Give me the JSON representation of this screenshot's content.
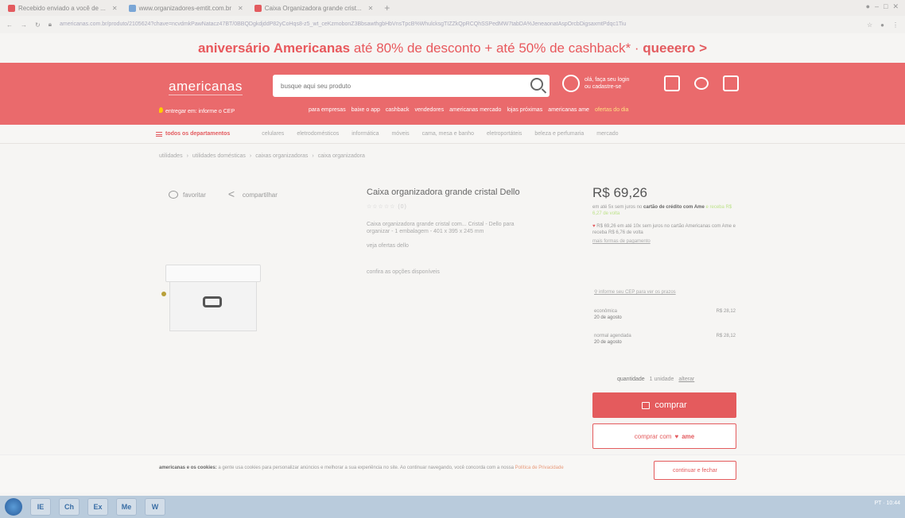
{
  "browser": {
    "tabs": [
      {
        "label": "Recebido enviado a você de ...",
        "color": "#e35b5f"
      },
      {
        "label": "www.organizadores-emtit.com.br",
        "color": "#7aa6d6"
      },
      {
        "label": "Caixa Organizadora grande crist...",
        "color": "#e35b5f"
      }
    ],
    "url": "americanas.com.br/produto/2105624?chave=ncvdmkPawNatacz47BT/0BBQDgkdjddP82yCoHqs8-z5_wt_ceKzmobonZ3BbsawthgbHbVnsTpcB%WhulcksgTIZZkQpRCQhSSPedMW7tabDA%JeneaonatAspOrcbDigsaxmtPdqc1Tiu"
  },
  "promo": {
    "pre": "aniversário ",
    "brand": "Americanas",
    "mid": " até 80% de desconto + até 50% de cashback* · ",
    "cta": "queeero >"
  },
  "header": {
    "logo": "americanas",
    "search_placeholder": "busque aqui seu produto",
    "account_line1": "olá, faça seu login",
    "account_line2": "ou cadastre-se",
    "location": "entregar em: informe o CEP",
    "quicklinks": [
      "para empresas",
      "baixe o app",
      "cashback",
      "vendedores",
      "americanas mercado",
      "lojas próximas",
      "americanas ame"
    ],
    "quicklink_highlight": "ofertas do dia"
  },
  "dept": {
    "button": "todos os departamentos",
    "categories": [
      "celulares",
      "eletrodomésticos",
      "informática",
      "móveis",
      "cama, mesa e banho",
      "eletroportáteis",
      "beleza e perfumaria",
      "mercado"
    ]
  },
  "breadcrumb": [
    "utilidades",
    "utilidades domésticas",
    "caixas organizadoras",
    "caixa organizadora"
  ],
  "product": {
    "favorite": "favoritar",
    "share": "compartilhar",
    "title": "Caixa organizadora grande cristal Dello",
    "stars": "☆☆☆☆☆ (0)",
    "description": "Caixa organizadora grande cristal com... Cristal - Dello para organizar - 1 embalagem - 401 x 395 x 245 mm",
    "brand_link": "veja ofertas dello",
    "seller_link": "confira as opções disponíveis"
  },
  "pricing": {
    "price": "R$ 69,26",
    "installments_pre": "em até 5x sem juros no ",
    "installments_bold": "cartão de crédito com Ame",
    "installments_post": " e receba R$ 6,27 de volta",
    "ame_line": "R$ 69,26 em até 10x sem juros no cartão Americanas com Ame e receba R$ 6,76 de volta",
    "more_payments": "mais formas de pagamento"
  },
  "shipping": {
    "cep_link": "informe seu CEP para ver os prazos",
    "options": [
      {
        "name": "econômica",
        "date": "20 de agosto",
        "price": "R$ 28,12"
      },
      {
        "name": "normal agendada",
        "date": "20 de agosto",
        "price": "R$ 28,12"
      }
    ]
  },
  "quantity": {
    "label": "quantidade",
    "value": "1 unidade",
    "change": "alterar"
  },
  "buttons": {
    "buy": "comprar",
    "ame_pre": "comprar com",
    "ame_brand": "ame"
  },
  "cookie": {
    "bold": "americanas e os cookies:",
    "text": " a gente usa cookies para personalizar anúncios e melhorar a sua experiência no site. Ao continuar navegando, você concorda com a nossa",
    "link": "Política de Privacidade",
    "button": "continuar e fechar"
  },
  "taskbar": {
    "apps": [
      "IE",
      "Ch",
      "Ex",
      "Me",
      "W"
    ],
    "tray": "PT · 10:44"
  },
  "colors": {
    "brand_red": "#e45b5d",
    "header_bg": "#ea6a6c"
  }
}
